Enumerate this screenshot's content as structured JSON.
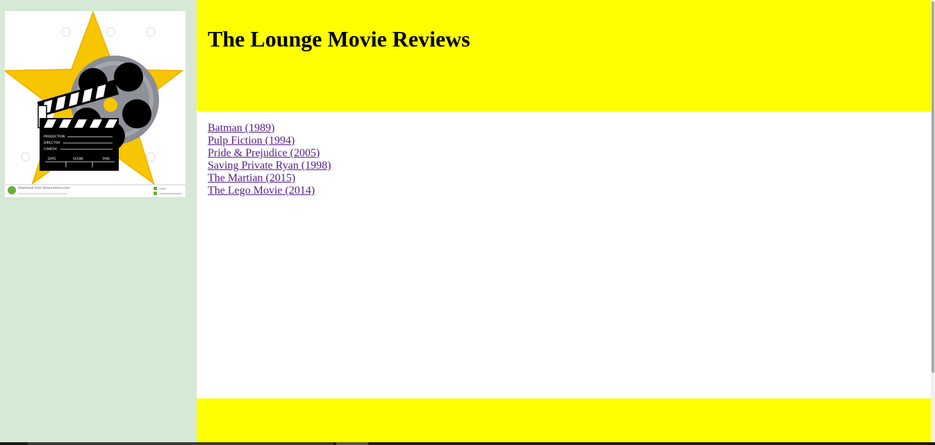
{
  "header": {
    "title": "The Lounge Movie Reviews"
  },
  "sidebar": {
    "logo_icon": "movie-star-clapperboard-icon",
    "logo_slate_labels": {
      "production": "PRODUCTION",
      "director": "DIRECTOR",
      "camera": "CAMERA",
      "date": "DATE",
      "scene": "SCENE",
      "take": "TAKE"
    },
    "logo_watermark": "Download from Dreamstime.com"
  },
  "reviews": [
    {
      "label": "Batman (1989)"
    },
    {
      "label": "Pulp Fiction (1994)"
    },
    {
      "label": "Pride & Prejudice (2005)"
    },
    {
      "label": "Saving Private Ryan (1998)"
    },
    {
      "label": "The Martian (2015)"
    },
    {
      "label": "The Lego Movie (2014)"
    }
  ],
  "colors": {
    "header_bg": "#ffff00",
    "footer_bg": "#ffff00",
    "sidebar_bg": "#d6e8d6",
    "link": "#551a8b",
    "star": "#f7c600"
  }
}
